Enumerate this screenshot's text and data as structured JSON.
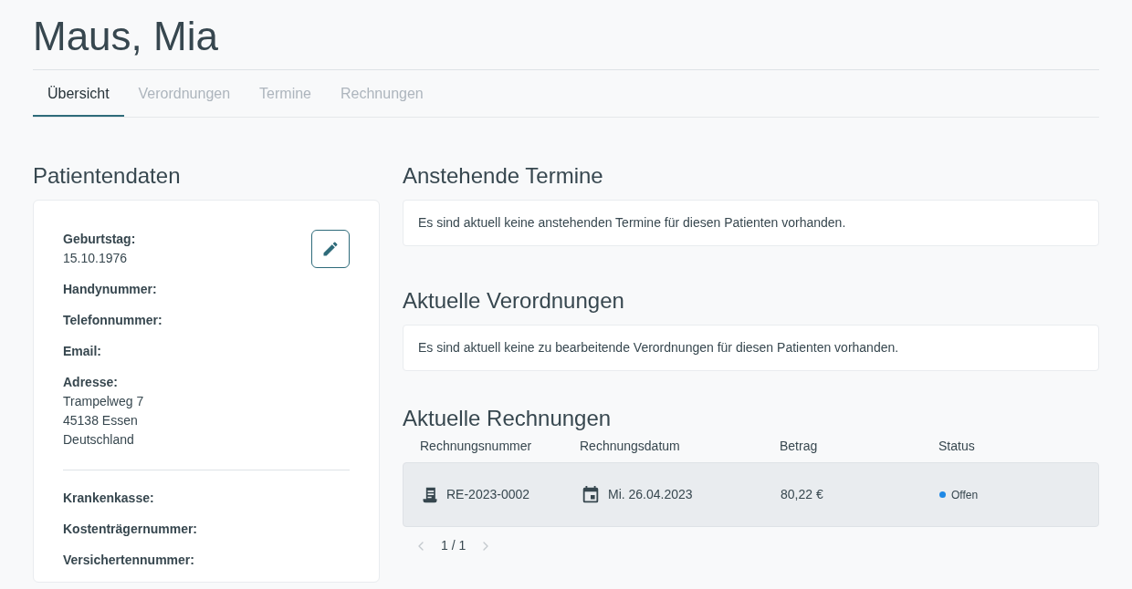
{
  "title": "Maus, Mia",
  "tabs": [
    {
      "label": "Übersicht",
      "selected": true
    },
    {
      "label": "Verordnungen",
      "selected": false
    },
    {
      "label": "Termine",
      "selected": false
    },
    {
      "label": "Rechnungen",
      "selected": false
    }
  ],
  "patient": {
    "heading": "Patientendaten",
    "sections": [
      [
        {
          "label": "Geburtstag:",
          "lines": [
            "15.10.1976"
          ]
        },
        {
          "label": "Handynummer:"
        },
        {
          "label": "Telefonnummer:"
        },
        {
          "label": "Email:"
        },
        {
          "label": "Adresse:",
          "lines": [
            "Trampelweg 7",
            "45138 Essen",
            "Deutschland"
          ]
        }
      ],
      [
        {
          "label": "Krankenkasse:"
        },
        {
          "label": "Kostenträgernummer:"
        },
        {
          "label": "Versichertennummer:"
        }
      ]
    ]
  },
  "appointments": {
    "heading": "Anstehende Termine",
    "message": "Es sind aktuell keine anstehenden Termine für diesen Patienten vorhanden."
  },
  "prescriptions": {
    "heading": "Aktuelle Verordnungen",
    "message": "Es sind aktuell keine zu bearbeitende Verordnungen für diesen Patienten vorhanden."
  },
  "invoices": {
    "heading": "Aktuelle Rechnungen",
    "columns": [
      "Rechnungsnummer",
      "Rechnungsdatum",
      "Betrag",
      "Status"
    ],
    "rows": [
      {
        "number": "RE-2023-0002",
        "date": "Mi. 26.04.2023",
        "amount": "80,22 €",
        "status": "Offen",
        "color": "#1e88e5"
      }
    ],
    "pagination": {
      "page": "1 / 1",
      "prev_disabled": true,
      "next_disabled": true
    }
  }
}
